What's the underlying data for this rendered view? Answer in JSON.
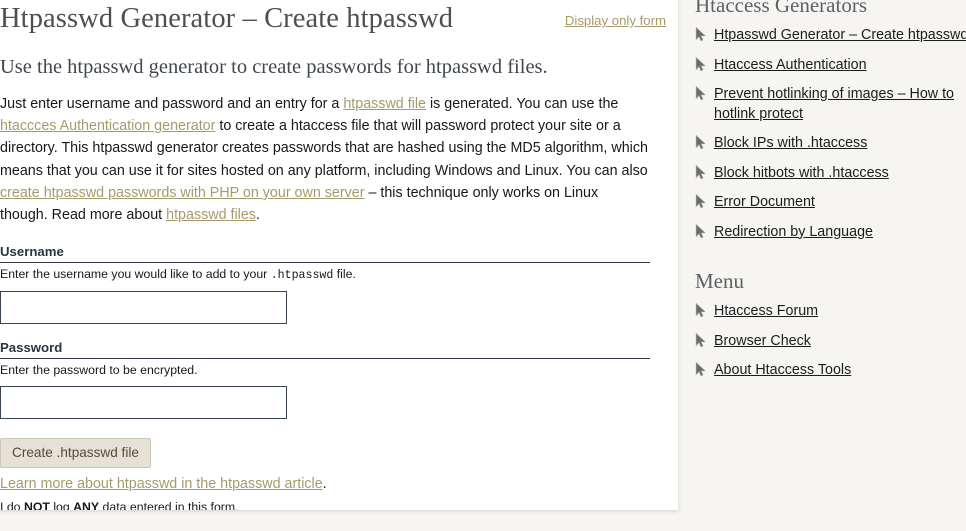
{
  "colors": {
    "page_background": "#f6f5f1",
    "card_background": "#ffffff",
    "link_gold": "#a79a6a",
    "heading_gray": "#4d4f52",
    "label_navy": "#2b3440",
    "button_background": "#e5e1d6",
    "button_text": "#5a4a33"
  },
  "main": {
    "title": "Htpasswd Generator – Create htpasswd",
    "display_only_form_label": "Display only form",
    "subtitle": "Use the htpasswd generator to create passwords for htpasswd files.",
    "intro": {
      "part1": "Just enter username and password and an entry for a ",
      "link1": "htpasswd file",
      "part2": " is generated. You can use the ",
      "link2": "htaccces Authentication generator",
      "part3": " to create a htaccess file that will password protect your site or a directory. This htpasswd generator creates passwords that are hashed using the MD5 algorithm, which means that you can use it for sites hosted on any platform, including Windows and Linux. You can also ",
      "link3": "create htpasswd passwords with PHP on your own server",
      "part4": " – this technique only works on Linux though. Read more about ",
      "link4": "htpasswd files",
      "part5": "."
    },
    "form": {
      "username": {
        "label": "Username",
        "help_before": "Enter the username you would like to add to your ",
        "help_mono": ".htpasswd",
        "help_after": " file.",
        "value": "",
        "placeholder": ""
      },
      "password": {
        "label": "Password",
        "help": "Enter the password to be encrypted.",
        "value": "",
        "placeholder": ""
      },
      "submit_label": "Create .htpasswd file"
    },
    "learn_more": {
      "link": "Learn more about htpasswd in the htpasswd article",
      "suffix": "."
    },
    "privacy": {
      "part1": "I do ",
      "bold1": "NOT",
      "part2": " log ",
      "bold2": "ANY",
      "part3": " data entered in this form."
    }
  },
  "sidebar": {
    "generators_heading": "Htaccess Generators",
    "generators": [
      {
        "label": "Htpasswd Generator – Create htpasswd",
        "wrap": false
      },
      {
        "label": "Htaccess Authentication",
        "wrap": false
      },
      {
        "label": "Prevent hotlinking of images – How to hotlink protect",
        "wrap": true
      },
      {
        "label": "Block IPs with .htaccess",
        "wrap": false
      },
      {
        "label": "Block hitbots with .htaccess",
        "wrap": false
      },
      {
        "label": "Error Document",
        "wrap": false
      },
      {
        "label": "Redirection by Language",
        "wrap": false
      }
    ],
    "menu_heading": "Menu",
    "menu": [
      {
        "label": "Htaccess Forum"
      },
      {
        "label": "Browser Check"
      },
      {
        "label": "About Htaccess Tools"
      }
    ]
  }
}
